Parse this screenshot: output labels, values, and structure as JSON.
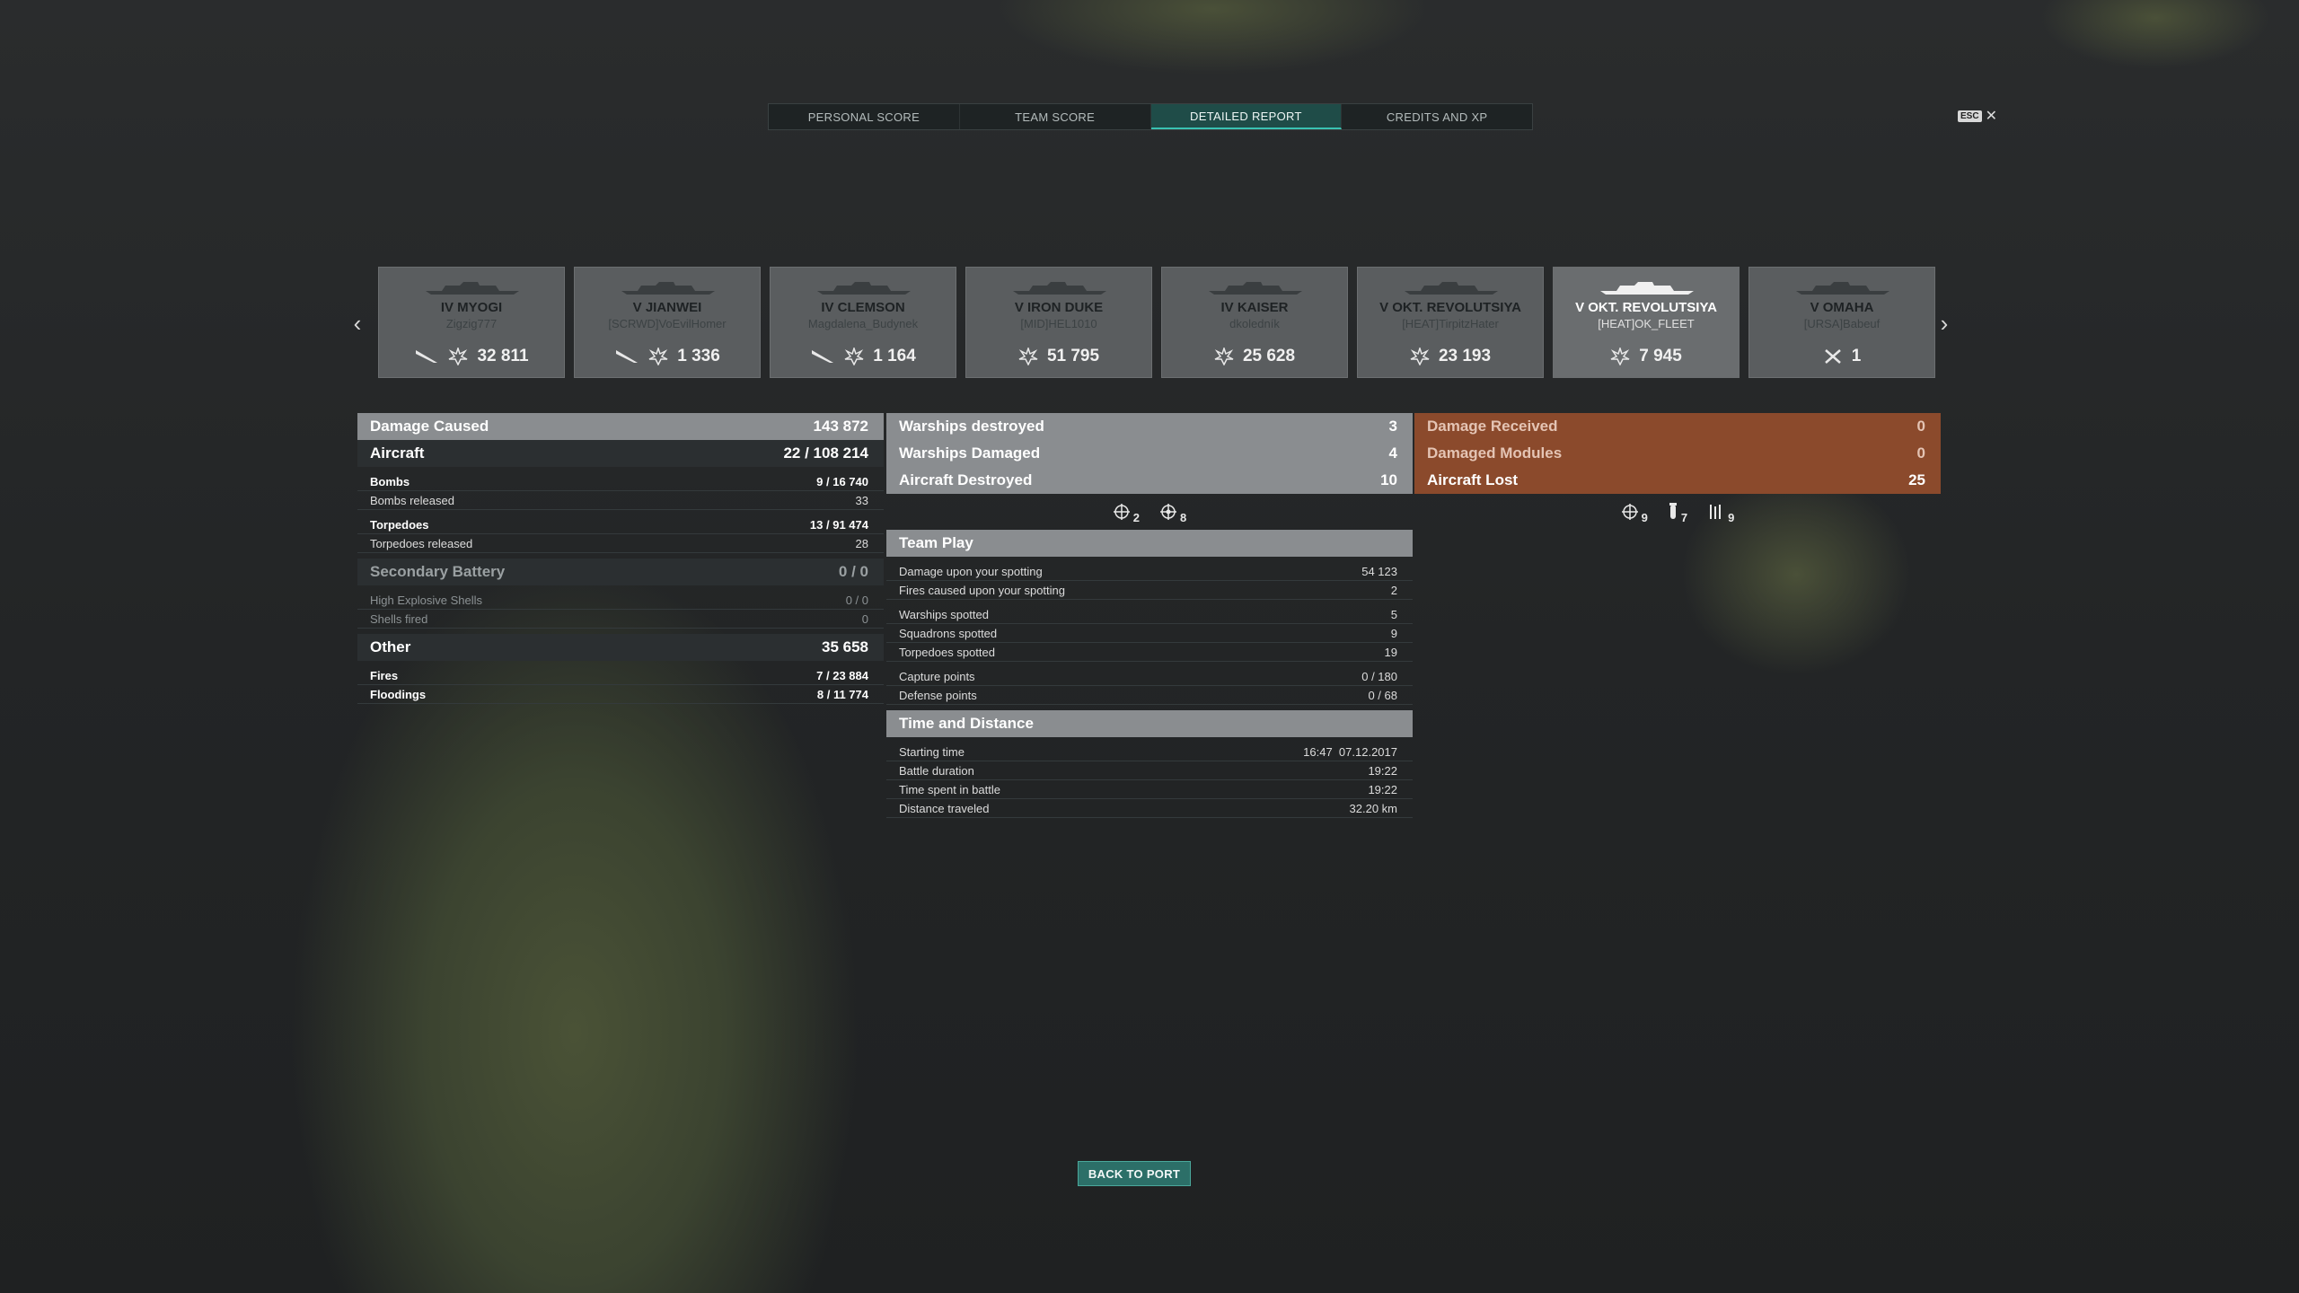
{
  "tabs": [
    "PERSONAL SCORE",
    "TEAM SCORE",
    "DETAILED REPORT",
    "CREDITS AND XP"
  ],
  "active_tab": "DETAILED REPORT",
  "esc": {
    "key": "ESC",
    "close": "✕"
  },
  "ships": [
    {
      "name": "IV MYOGI",
      "player": "Zigzig777",
      "value": "32 811",
      "icons": [
        "aircraft-icon",
        "damage-icon"
      ]
    },
    {
      "name": "V JIANWEI",
      "player": "[SCRWD]VoEvilHomer",
      "value": "1 336",
      "icons": [
        "aircraft-icon",
        "damage-icon"
      ]
    },
    {
      "name": "IV CLEMSON",
      "player": "Magdalena_Budynek",
      "value": "1 164",
      "icons": [
        "aircraft-icon",
        "damage-icon"
      ]
    },
    {
      "name": "V IRON DUKE",
      "player": "[MID]HEL1010",
      "value": "51 795",
      "icons": [
        "damage-icon"
      ]
    },
    {
      "name": "IV KAISER",
      "player": "dkoledník",
      "value": "25 628",
      "icons": [
        "damage-icon"
      ]
    },
    {
      "name": "V OKT. REVOLUTSIYA",
      "player": "[HEAT]TirpitzHater",
      "value": "23 193",
      "icons": [
        "damage-icon"
      ]
    },
    {
      "name": "V OKT. REVOLUTSIYA",
      "player": "[HEAT]OK_FLEET",
      "value": "7 945",
      "icons": [
        "damage-icon"
      ],
      "selected": true
    },
    {
      "name": "V OMAHA",
      "player": "[URSA]Babeuf",
      "value": "1",
      "icons": [
        "frags-icon"
      ]
    }
  ],
  "left": {
    "damage_caused": {
      "label": "Damage Caused",
      "value": "143 872"
    },
    "aircraft": {
      "label": "Aircraft",
      "hits": "22",
      "dmg": "108 214"
    },
    "bombs": {
      "label": "Bombs",
      "hits": "9",
      "dmg": "16 740"
    },
    "bombs_released": {
      "label": "Bombs released",
      "value": "33"
    },
    "torpedoes": {
      "label": "Torpedoes",
      "hits": "13",
      "dmg": "91 474"
    },
    "torpedoes_released": {
      "label": "Torpedoes released",
      "value": "28"
    },
    "secondary": {
      "label": "Secondary Battery",
      "value": "0 / 0"
    },
    "he_shells": {
      "label": "High Explosive Shells",
      "value": "0 / 0"
    },
    "shells_fired": {
      "label": "Shells fired",
      "value": "0"
    },
    "other": {
      "label": "Other",
      "value": "35 658"
    },
    "fires": {
      "label": "Fires",
      "hits": "7",
      "dmg": "23 884"
    },
    "floodings": {
      "label": "Floodings",
      "hits": "8",
      "dmg": "11 774"
    }
  },
  "middle": {
    "warships_destroyed": {
      "label": "Warships destroyed",
      "value": "3"
    },
    "warships_damaged": {
      "label": "Warships Damaged",
      "value": "4"
    },
    "aircraft_destroyed": {
      "label": "Aircraft Destroyed",
      "value": "10"
    },
    "aircraft_icons": [
      "2",
      "8"
    ],
    "team_play": {
      "title": "Team Play",
      "rows": [
        {
          "label": "Damage upon your spotting",
          "value": "54 123"
        },
        {
          "label": "Fires caused upon your spotting",
          "value": "2"
        },
        {
          "label": "Warships spotted",
          "value": "5"
        },
        {
          "label": "Squadrons spotted",
          "value": "9"
        },
        {
          "label": "Torpedoes spotted",
          "value": "19"
        },
        {
          "label": "Capture points",
          "value": "0 / 180"
        },
        {
          "label": "Defense points",
          "value": "0 / 68"
        }
      ]
    },
    "time_distance": {
      "title": "Time and Distance",
      "rows": [
        {
          "label": "Starting time",
          "value": "16:47  07.12.2017"
        },
        {
          "label": "Battle duration",
          "value": "19:22"
        },
        {
          "label": "Time spent in battle",
          "value": "19:22"
        },
        {
          "label": "Distance traveled",
          "value": "32.20 km"
        }
      ]
    }
  },
  "right": {
    "damage_received": {
      "label": "Damage Received",
      "value": "0"
    },
    "damaged_modules": {
      "label": "Damaged Modules",
      "value": "0"
    },
    "aircraft_lost": {
      "label": "Aircraft Lost",
      "value": "25"
    },
    "lost_icons": [
      "9",
      "7",
      "9"
    ]
  },
  "back_to_port": "BACK TO PORT",
  "colors": {
    "accent": "#1f4c48",
    "received": "#8b4a2c",
    "header": "#8a8d90"
  }
}
